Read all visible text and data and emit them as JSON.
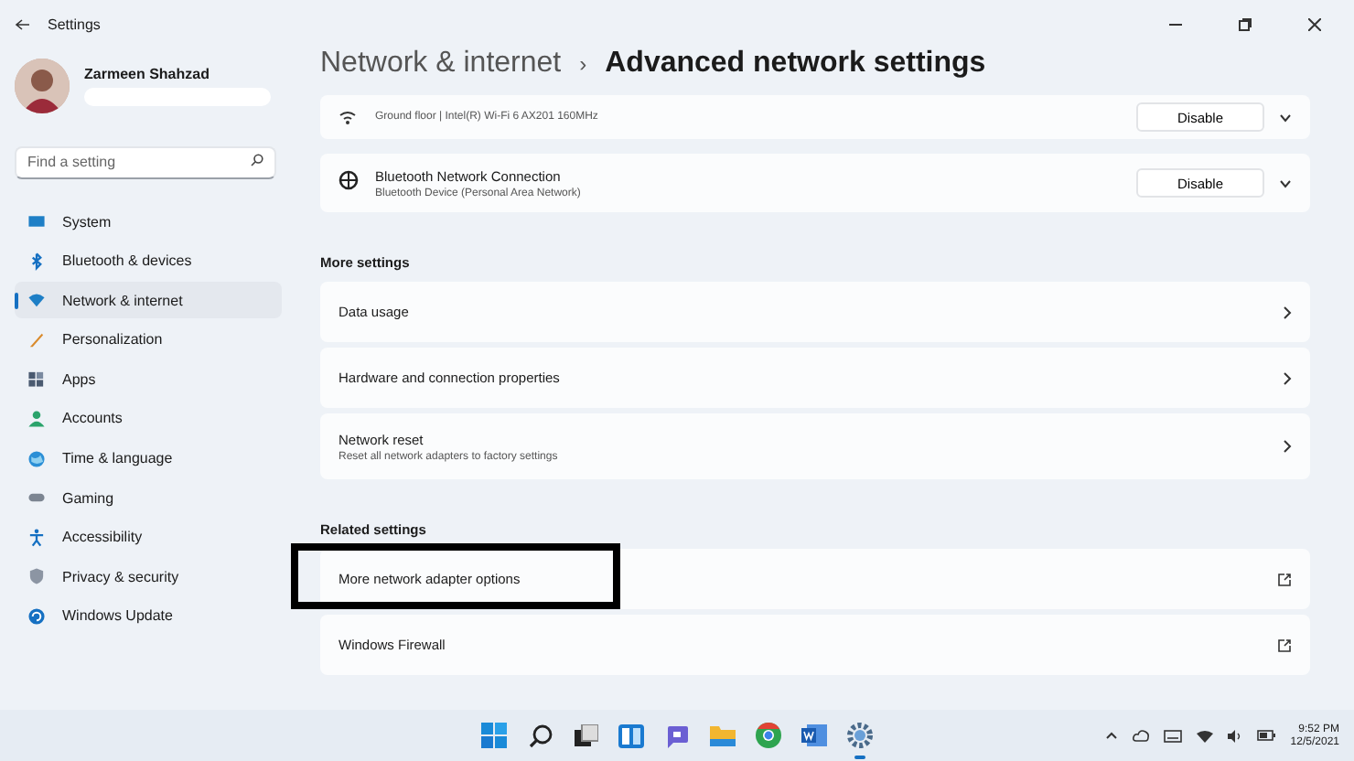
{
  "window": {
    "title": "Settings"
  },
  "user": {
    "name": "Zarmeen Shahzad"
  },
  "search": {
    "placeholder": "Find a setting"
  },
  "sidebar": {
    "items": [
      {
        "label": "System",
        "selected": false
      },
      {
        "label": "Bluetooth & devices",
        "selected": false
      },
      {
        "label": "Network & internet",
        "selected": true
      },
      {
        "label": "Personalization",
        "selected": false
      },
      {
        "label": "Apps",
        "selected": false
      },
      {
        "label": "Accounts",
        "selected": false
      },
      {
        "label": "Time & language",
        "selected": false
      },
      {
        "label": "Gaming",
        "selected": false
      },
      {
        "label": "Accessibility",
        "selected": false
      },
      {
        "label": "Privacy & security",
        "selected": false
      },
      {
        "label": "Windows Update",
        "selected": false
      }
    ]
  },
  "breadcrumb": {
    "parent": "Network & internet",
    "separator": "›",
    "current": "Advanced network settings"
  },
  "adapters": [
    {
      "subtitle": "Ground floor | Intel(R) Wi-Fi 6 AX201 160MHz",
      "button": "Disable",
      "kind": "wifi"
    },
    {
      "title": "Bluetooth Network Connection",
      "subtitle": "Bluetooth Device (Personal Area Network)",
      "button": "Disable",
      "kind": "globe"
    }
  ],
  "sections": [
    {
      "heading": "More settings",
      "items": [
        {
          "title": "Data usage",
          "kind": "chevron"
        },
        {
          "title": "Hardware and connection properties",
          "kind": "chevron"
        },
        {
          "title": "Network reset",
          "subtitle": "Reset all network adapters to factory settings",
          "kind": "chevron"
        }
      ]
    },
    {
      "heading": "Related settings",
      "items": [
        {
          "title": "More network adapter options",
          "kind": "external",
          "highlighted": true
        },
        {
          "title": "Windows Firewall",
          "kind": "external"
        }
      ]
    }
  ],
  "taskbar": {
    "time": "9:52 PM",
    "date": "12/5/2021"
  }
}
